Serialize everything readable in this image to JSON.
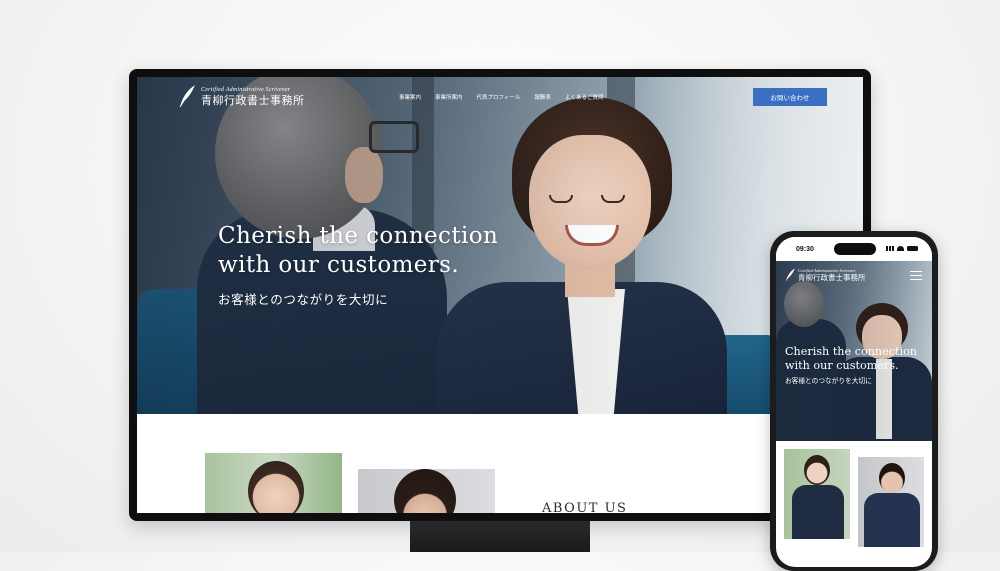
{
  "desktop": {
    "logo": {
      "subtitle": "Certified Administrative Scrivener",
      "name": "青柳行政書士事務所"
    },
    "nav": [
      {
        "label": "事業案内"
      },
      {
        "label": "事業所案内"
      },
      {
        "label": "代表プロフィール"
      },
      {
        "label": "報酬表"
      },
      {
        "label": "よくあるご質問"
      }
    ],
    "contact_button": "お問い合わせ",
    "hero": {
      "headline_line1": "Cherish the connection",
      "headline_line2": "with our customers.",
      "subheadline": "お客様とのつながりを大切に"
    },
    "about_heading": "ABOUT US"
  },
  "phone": {
    "time": "09:30",
    "logo": {
      "subtitle": "Certified Administrative Scrivener",
      "name": "青柳行政書士事務所"
    },
    "hero": {
      "headline_line1": "Cherish the connection",
      "headline_line2": "with our customers.",
      "subheadline": "お客様とのつながりを大切に"
    }
  },
  "colors": {
    "accent": "#3a6fc1",
    "navy": "#1c2a40"
  },
  "icons": [
    "feather-icon",
    "menu-icon",
    "signal-icon",
    "wifi-icon",
    "battery-icon"
  ]
}
